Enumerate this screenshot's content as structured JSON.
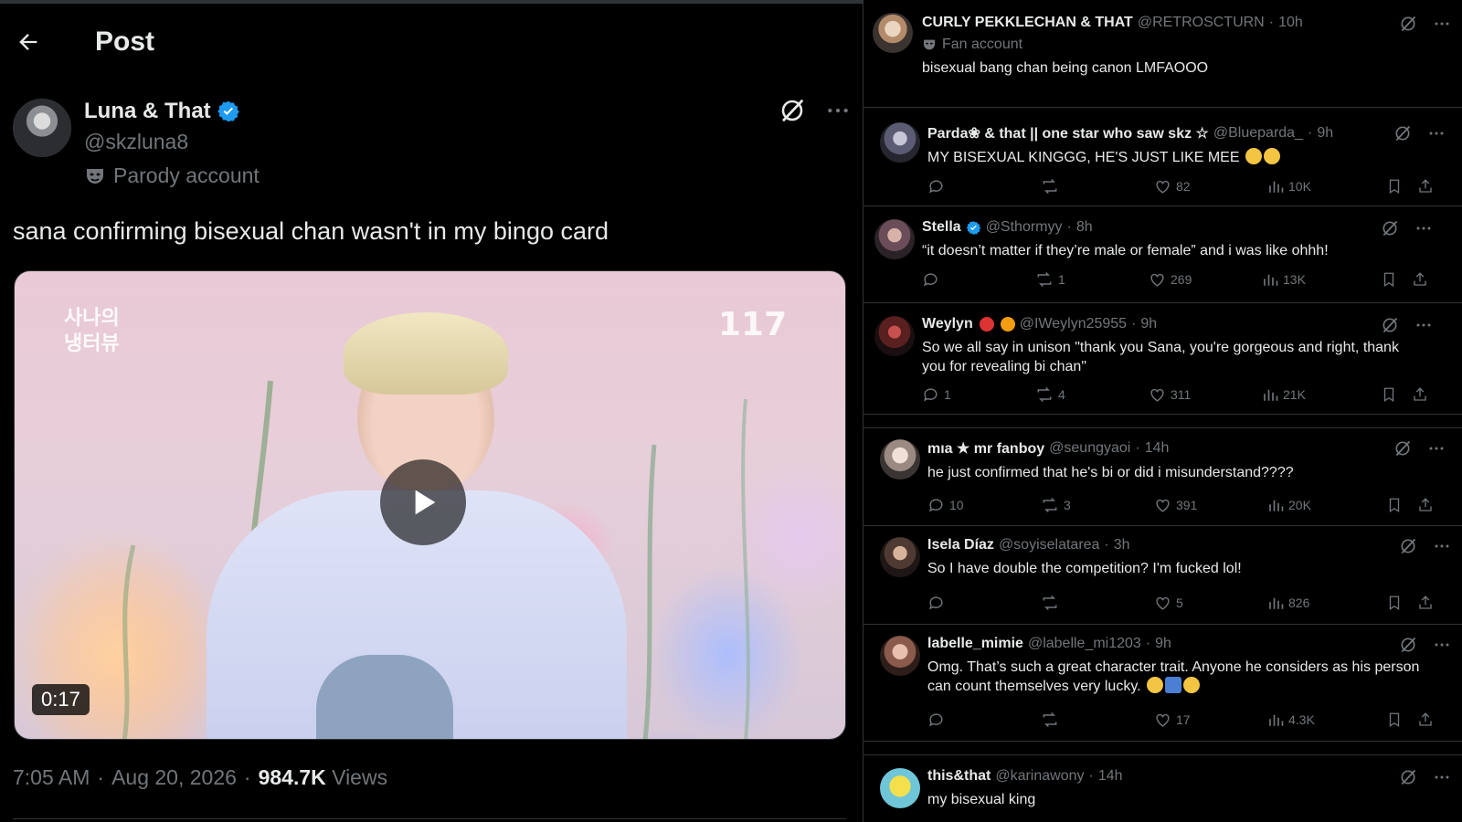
{
  "header": {
    "title": "Post"
  },
  "post": {
    "author_name": "Luna & That",
    "author_handle": "@skzluna8",
    "account_label": "Parody account",
    "text": "sana confirming bisexual chan wasn't in my bingo card",
    "video": {
      "duration": "0:17",
      "logo_left": "사나의 냉터뷰",
      "logo_right": "117"
    },
    "time": "7:05 AM",
    "date": "Aug 20, 2026",
    "views_count": "984.7K",
    "views_label": "Views"
  },
  "colors": {
    "background": "#000000",
    "text": "#e7e9ea",
    "muted": "#71767b",
    "verified": "#1d9bf0",
    "border": "#2f3336"
  },
  "replies": [
    {
      "name": "CURLY PEKKLECHAN & THAT",
      "handle": "@RETROSCTURN",
      "time": "10h",
      "tag": "Fan account",
      "text": "bisexual bang chan being canon LMFAOOO",
      "show_actions": false
    },
    {
      "name": "Parda❀ & that || one star who saw skz ☆",
      "handle": "@Bluepardа_",
      "time": "9h",
      "text": "MY BISEXUAL KINGGG, HE'S JUST LIKE MEE",
      "reply_count": "",
      "repost_count": "",
      "like_count": "82",
      "view_count": "10K"
    },
    {
      "name": "Stella",
      "handle": "@Sthormyy",
      "time": "8h",
      "verified": true,
      "text": "“it doesn’t matter if they’re male or female” and i was like ohhh!",
      "reply_count": "",
      "repost_count": "1",
      "like_count": "269",
      "view_count": "13K"
    },
    {
      "name": "Weylyn",
      "handle": "@IWeylyn25955",
      "time": "9h",
      "text": "So we all say in unison \"thank you Sana, you're gorgeous and right, thank you for revealing bi chan\"",
      "reply_count": "1",
      "repost_count": "4",
      "like_count": "311",
      "view_count": "21K"
    },
    {
      "name": "mıa ★ mr fanboy",
      "handle": "@seungyaoi",
      "time": "14h",
      "text": "he just confirmed that he's bi or did i misunderstand????",
      "reply_count": "10",
      "repost_count": "3",
      "like_count": "391",
      "view_count": "20K"
    },
    {
      "name": "Isela Díaz",
      "handle": "@soyiselatarea",
      "time": "3h",
      "text": "So I have double the competition? I'm fucked  lol!",
      "reply_count": "",
      "repost_count": "",
      "like_count": "5",
      "view_count": "826"
    },
    {
      "name": "labelle_mimie",
      "handle": "@labelle_mi1203",
      "time": "9h",
      "text": "Omg. That’s such a great character trait. Anyone he considers as his person can count themselves very lucky.",
      "reply_count": "",
      "repost_count": "",
      "like_count": "17",
      "view_count": "4.3K"
    },
    {
      "name": "this&that",
      "handle": "@karinawony",
      "time": "14h",
      "text": "my bisexual king"
    }
  ],
  "separator": "·",
  "icons": [
    "back-arrow-icon",
    "verified-badge-icon",
    "parody-mask-icon",
    "grok-icon",
    "more-icon",
    "play-icon",
    "reply-icon",
    "repost-icon",
    "like-icon",
    "views-icon",
    "bookmark-icon",
    "share-icon"
  ]
}
